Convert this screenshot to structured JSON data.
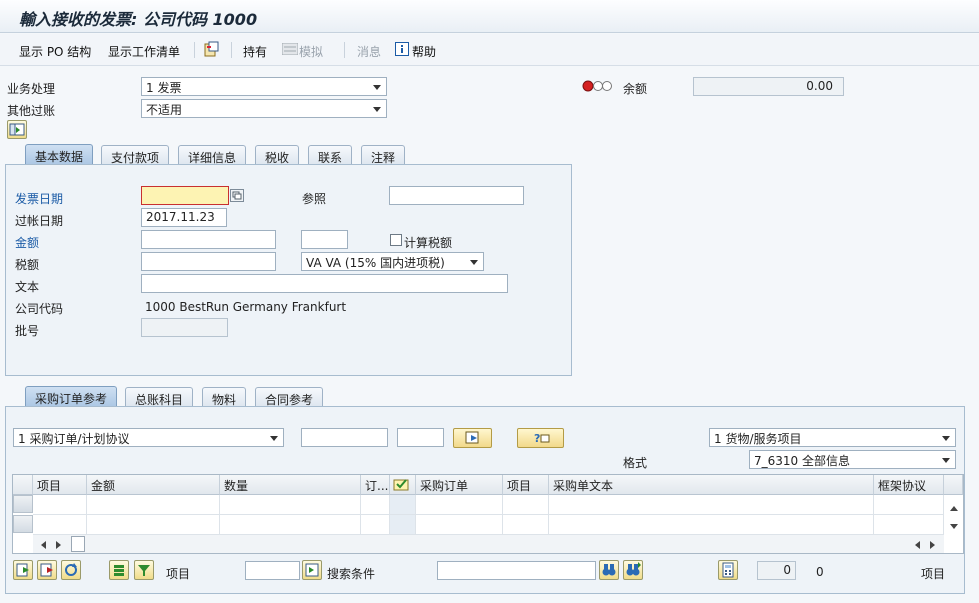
{
  "title": "輸入接收的发票: 公司代码 1000",
  "toolbar": {
    "show_po_structure": "显示 PO 结构",
    "show_worklist": "显示工作清单",
    "hold": "持有",
    "simulate": "模拟",
    "messages": "消息",
    "help": "帮助"
  },
  "header": {
    "transaction_label": "业务处理",
    "transaction_value": "1 发票",
    "other_posting_label": "其他过账",
    "other_posting_value": "不适用",
    "balance_label": "余额",
    "balance_value": "0.00"
  },
  "tabs_top": [
    "基本数据",
    "支付款项",
    "详细信息",
    "税收",
    "联系",
    "注释"
  ],
  "basic": {
    "invoice_date_label": "发票日期",
    "invoice_date_value": "",
    "reference_label": "参照",
    "reference_value": "",
    "posting_date_label": "过帐日期",
    "posting_date_value": "2017.11.23",
    "amount_label": "金额",
    "amount_value": "",
    "currency_value": "",
    "calc_tax_label": "计算税额",
    "tax_label": "税额",
    "tax_value": "",
    "tax_code_value": "VA VA (15% 国内进项税)",
    "text_label": "文本",
    "text_value": "",
    "company_code_label": "公司代码",
    "company_code_value": "1000 BestRun Germany Frankfurt",
    "batch_label": "批号",
    "batch_value": ""
  },
  "tabs_bottom": [
    "采购订单参考",
    "总账科目",
    "物料",
    "合同参考"
  ],
  "po_ref": {
    "ref_type_value": "1 采购订单/计划协议",
    "po_number_value": "",
    "item_value": "",
    "layout_type_value": "1 货物/服务项目",
    "format_label": "格式",
    "format_value": "7_6310 全部信息"
  },
  "grid": {
    "columns": [
      "项目",
      "金额",
      "数量",
      "订...",
      "",
      "采购订单",
      "项目",
      "采购单文本",
      "框架协议"
    ]
  },
  "footer": {
    "item_label": "项目",
    "item_value": "",
    "search_label": "搜索条件",
    "search_value": "",
    "count_value": "0",
    "count_text": "0",
    "item_label_right": "项目"
  },
  "colors": {
    "accent": "#1b5ba6",
    "tab_active": "#a9c5e3",
    "required": "#c83030"
  }
}
